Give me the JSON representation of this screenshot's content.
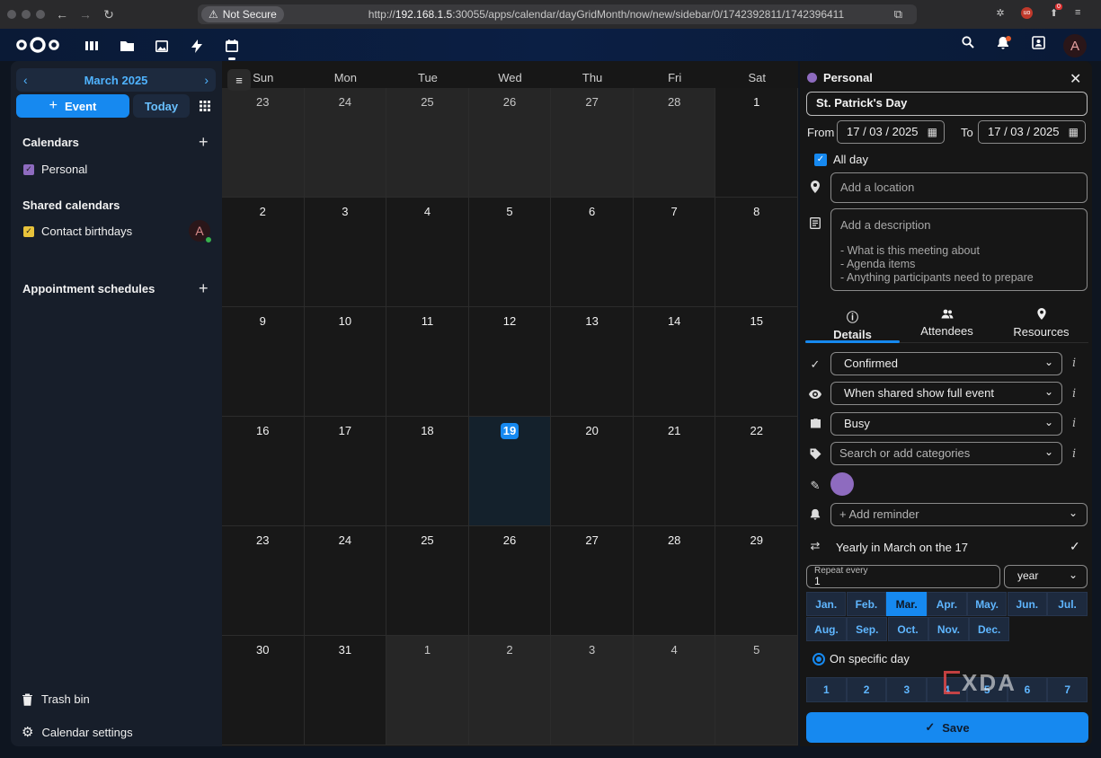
{
  "browser": {
    "not_secure": "Not Secure",
    "url_prefix": "http://",
    "url_host": "192.168.1.5",
    "url_rest": ":30055/apps/calendar/dayGridMonth/now/new/sidebar/0/1742392811/1742396411",
    "ext_badge_1": "0"
  },
  "header": {
    "avatar_letter": "A",
    "apps": [
      "dashboard-icon",
      "files-icon",
      "photos-icon",
      "activity-icon",
      "calendar-icon"
    ]
  },
  "sidebar": {
    "month_title": "March 2025",
    "event_label": "Event",
    "today_label": "Today",
    "calendars_title": "Calendars",
    "personal_label": "Personal",
    "personal_color": "#8e6bbf",
    "shared_title": "Shared calendars",
    "birthdays_label": "Contact birthdays",
    "birthdays_color": "#e8c33b",
    "shared_avatar": "A",
    "appointments_title": "Appointment schedules",
    "trash_label": "Trash bin",
    "settings_label": "Calendar settings"
  },
  "calendar": {
    "weekdays": [
      "Sun",
      "Mon",
      "Tue",
      "Wed",
      "Thu",
      "Fri",
      "Sat"
    ],
    "weeks": [
      [
        {
          "n": "23",
          "o": true
        },
        {
          "n": "24",
          "o": true
        },
        {
          "n": "25",
          "o": true
        },
        {
          "n": "26",
          "o": true
        },
        {
          "n": "27",
          "o": true
        },
        {
          "n": "28",
          "o": true
        },
        {
          "n": "1",
          "o": false
        }
      ],
      [
        {
          "n": "2",
          "o": false
        },
        {
          "n": "3",
          "o": false
        },
        {
          "n": "4",
          "o": false
        },
        {
          "n": "5",
          "o": false
        },
        {
          "n": "6",
          "o": false
        },
        {
          "n": "7",
          "o": false
        },
        {
          "n": "8",
          "o": false
        }
      ],
      [
        {
          "n": "9",
          "o": false
        },
        {
          "n": "10",
          "o": false
        },
        {
          "n": "11",
          "o": false
        },
        {
          "n": "12",
          "o": false
        },
        {
          "n": "13",
          "o": false
        },
        {
          "n": "14",
          "o": false
        },
        {
          "n": "15",
          "o": false
        }
      ],
      [
        {
          "n": "16",
          "o": false
        },
        {
          "n": "17",
          "o": false
        },
        {
          "n": "18",
          "o": false
        },
        {
          "n": "19",
          "o": false,
          "today": true
        },
        {
          "n": "20",
          "o": false
        },
        {
          "n": "21",
          "o": false
        },
        {
          "n": "22",
          "o": false
        }
      ],
      [
        {
          "n": "23",
          "o": false
        },
        {
          "n": "24",
          "o": false
        },
        {
          "n": "25",
          "o": false
        },
        {
          "n": "26",
          "o": false
        },
        {
          "n": "27",
          "o": false
        },
        {
          "n": "28",
          "o": false
        },
        {
          "n": "29",
          "o": false
        }
      ],
      [
        {
          "n": "30",
          "o": false
        },
        {
          "n": "31",
          "o": false
        },
        {
          "n": "1",
          "o": true
        },
        {
          "n": "2",
          "o": true
        },
        {
          "n": "3",
          "o": true
        },
        {
          "n": "4",
          "o": true
        },
        {
          "n": "5",
          "o": true
        }
      ]
    ]
  },
  "editor": {
    "calendar_name": "Personal",
    "calendar_color": "#8e6bbf",
    "title": "St. Patrick's Day",
    "from_label": "From",
    "from_date": "17 / 03 / 2025",
    "to_label": "To",
    "to_date": "17 / 03 / 2025",
    "all_day_label": "All day",
    "location_placeholder": "Add a location",
    "description_placeholder": "Add a description",
    "description_hints": [
      "- What is this meeting about",
      "- Agenda items",
      "- Anything participants need to prepare"
    ],
    "tabs": [
      "Details",
      "Attendees",
      "Resources"
    ],
    "status": "Confirmed",
    "visibility": "When shared show full event",
    "availability": "Busy",
    "categories_placeholder": "Search or add categories",
    "reminder_label": "+ Add reminder",
    "repeat_summary": "Yearly in March on the 17",
    "repeat_every_label": "Repeat every",
    "repeat_every_value": "1",
    "repeat_unit": "year",
    "months": [
      "Jan.",
      "Feb.",
      "Mar.",
      "Apr.",
      "May.",
      "Jun.",
      "Jul.",
      "Aug.",
      "Sep.",
      "Oct.",
      "Nov.",
      "Dec."
    ],
    "selected_month": "Mar.",
    "specific_day_label": "On specific day",
    "days_row": [
      "1",
      "2",
      "3",
      "4",
      "5",
      "6",
      "7"
    ],
    "save_label": "Save"
  },
  "watermark": "XDA"
}
